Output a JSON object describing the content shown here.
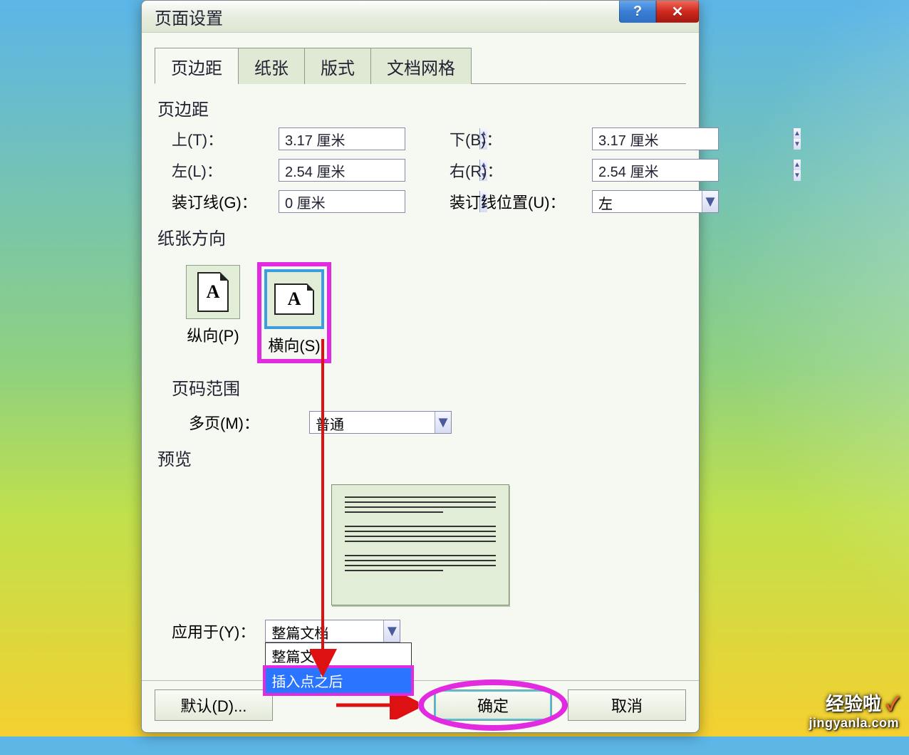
{
  "dialog": {
    "title": "页面设置",
    "tabs": [
      "页边距",
      "纸张",
      "版式",
      "文档网格"
    ],
    "active_tab": 0
  },
  "margins": {
    "section": "页边距",
    "top_label": "上(T)：",
    "top_value": "3.17 厘米",
    "bottom_label": "下(B)：",
    "bottom_value": "3.17 厘米",
    "left_label": "左(L)：",
    "left_value": "2.54 厘米",
    "right_label": "右(R)：",
    "right_value": "2.54 厘米",
    "gutter_label": "装订线(G)：",
    "gutter_value": "0 厘米",
    "gutter_pos_label": "装订线位置(U)：",
    "gutter_pos_value": "左"
  },
  "orientation": {
    "section": "纸张方向",
    "portrait": "纵向(P)",
    "landscape": "横向(S)",
    "glyph": "A"
  },
  "page_range": {
    "section": "页码范围",
    "multi_label": "多页(M)：",
    "multi_value": "普通"
  },
  "preview": {
    "section": "预览"
  },
  "apply": {
    "label": "应用于(Y)：",
    "value": "整篇文档",
    "options": [
      "整篇文档",
      "插入点之后"
    ],
    "selected_index": 1
  },
  "buttons": {
    "default": "默认(D)...",
    "ok": "确定",
    "cancel": "取消"
  },
  "badge": {
    "brand": "经验啦",
    "mark": "✓",
    "site": "jingyanla.com"
  }
}
